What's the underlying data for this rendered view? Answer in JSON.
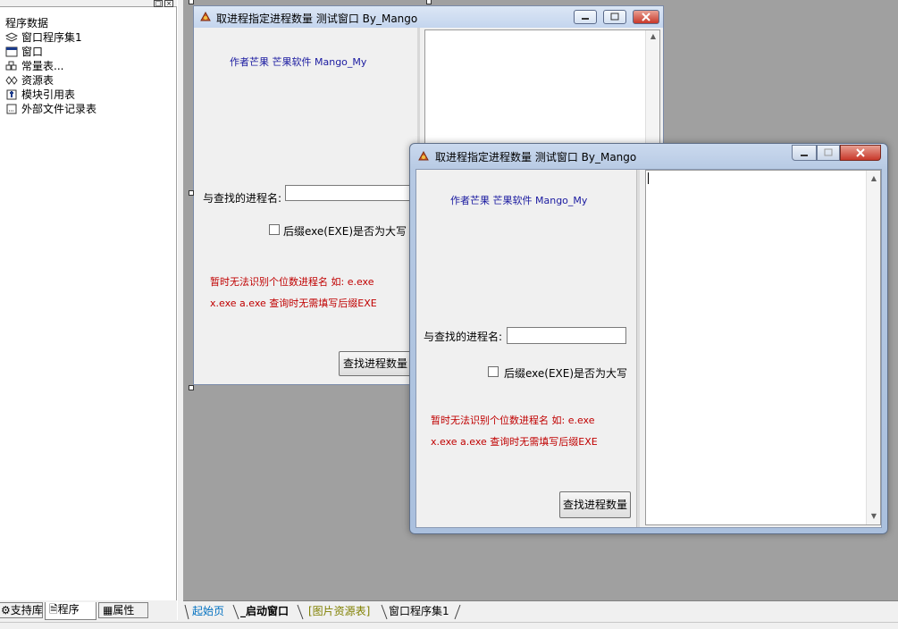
{
  "left_panel": {
    "tree": {
      "root": "程序数据",
      "items": [
        {
          "label": "窗口程序集1",
          "icon": "layers-icon"
        },
        {
          "label": "窗口",
          "icon": "window-icon"
        },
        {
          "label": "常量表...",
          "icon": "cubes-icon"
        },
        {
          "label": "资源表",
          "icon": "resource-icon"
        },
        {
          "label": "模块引用表",
          "icon": "module-icon"
        },
        {
          "label": "外部文件记录表",
          "icon": "file-list-icon"
        }
      ]
    },
    "tabs": [
      {
        "label": "支持库"
      },
      {
        "label": "程序"
      },
      {
        "label": "属性"
      }
    ]
  },
  "doc_tabs": [
    {
      "label": "起始页",
      "color": "#0070c0"
    },
    {
      "label": "_启动窗口",
      "color": "#000000"
    },
    {
      "label": "[图片资源表]",
      "color": "#808000"
    },
    {
      "label": "窗口程序集1",
      "color": "#000000"
    }
  ],
  "design_window": {
    "title": "取进程指定进程数量 测试窗口  By_Mango",
    "author": "作者芒果 芒果软件 Mango_My",
    "search_label": "与查找的进程名:",
    "checkbox_label": "后缀exe(EXE)是否为大写",
    "note_line1": "暂时无法识别个位数进程名 如: e.exe",
    "note_line2": "x.exe a.exe 查询时无需填写后缀EXE",
    "button_label": "查找进程数量"
  },
  "run_window": {
    "title": "取进程指定进程数量 测试窗口  By_Mango",
    "author": "作者芒果 芒果软件 Mango_My",
    "search_label": "与查找的进程名:",
    "search_value": "",
    "checkbox_label": "后缀exe(EXE)是否为大写",
    "checkbox_checked": false,
    "note_line1": "暂时无法识别个位数进程名 如: e.exe",
    "note_line2": "x.exe a.exe 查询时无需填写后缀EXE",
    "button_label": "查找进程数量"
  },
  "colors": {
    "author_text": "#1a1aa0",
    "note_text": "#c00000",
    "workspace": "#a0a0a0"
  }
}
